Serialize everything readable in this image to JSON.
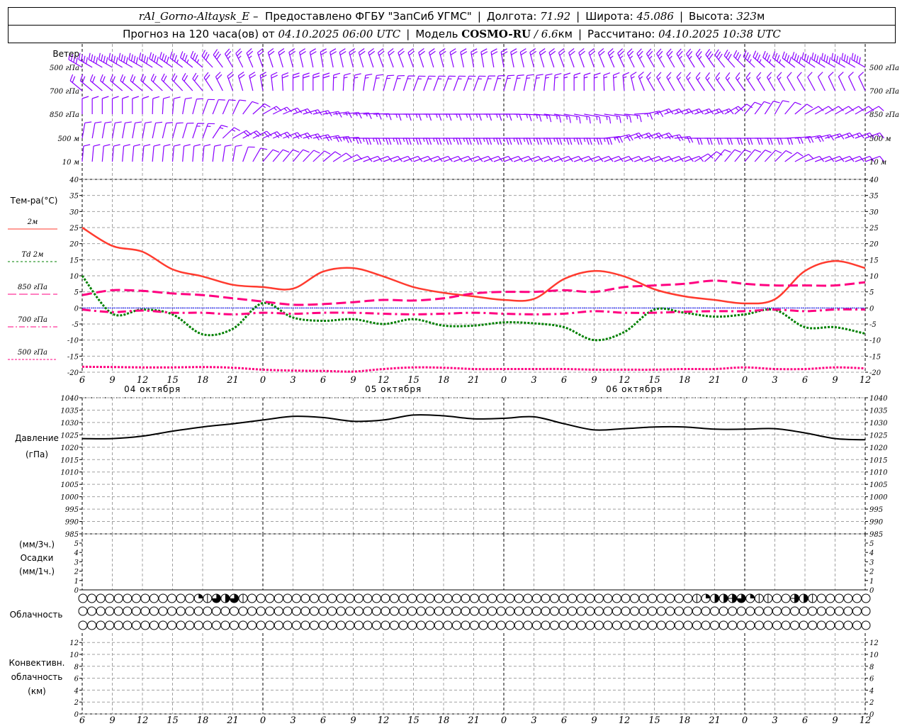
{
  "header": {
    "station": "rAl_Gorno-Altaysk_E",
    "provided_by": " –  Предоставлено ФГБУ \"ЗапСиб УГМС\"",
    "lon_label": "Долгота: ",
    "lon": "71.92",
    "lat_label": "Широта: ",
    "lat": "45.086",
    "alt_label": "Высота: ",
    "alt": "323",
    "alt_unit": "м",
    "forecast_prefix": "Прогноз на 120 часа(ов) от ",
    "forecast_start": "04.10.2025 06:00 UTC",
    "model_label": "Модель ",
    "model": "COSMO-RU",
    "resolution": " / 6.6",
    "resolution_unit": "км",
    "computed_label": "Рассчитано: ",
    "computed": "04.10.2025 10:38 UTC"
  },
  "labels": {
    "wind": "Ветер",
    "wind_levels": [
      "500 гПа",
      "700 гПа",
      "850 гПа",
      "500 м",
      "10 м"
    ],
    "temp_title": "Тем-ра(°C)",
    "legend": [
      "2м",
      "Td  2м",
      "850  гПа",
      "700  гПа",
      "500  гПа"
    ],
    "pressure": "Давление",
    "pressure_unit": "(гПа)",
    "precip_3h": "(мм/3ч.)",
    "precip": "Осадки",
    "precip_1h": "(мм/1ч.)",
    "clouds": "Облачность",
    "conv1": "Конвективн.",
    "conv2": "облачность",
    "conv3": "(км)"
  },
  "x_axis": {
    "ticks": [
      "6",
      "9",
      "12",
      "15",
      "18",
      "21",
      "0",
      "3",
      "6",
      "9",
      "12",
      "15",
      "18",
      "21",
      "0",
      "3",
      "6",
      "9",
      "12",
      "15",
      "18",
      "21",
      "0",
      "3",
      "6",
      "9",
      "12"
    ],
    "dates": [
      "04 октября",
      "05 октября",
      "06 октября"
    ]
  },
  "colors": {
    "wind": "#8a00ff",
    "t2m": "#ff3b2f",
    "td2m": "#008000",
    "levels": "#ff0080",
    "zero_line": "#0000ff",
    "grid": "#a0a0a0"
  },
  "chart_data": [
    {
      "type": "wind-barbs",
      "units": "direction deg / speed m/s, every 3 h",
      "rows": [
        {
          "name": "500 гПа",
          "dir": [
            300,
            300,
            300,
            305,
            310,
            330,
            340,
            345,
            350,
            345,
            340,
            340,
            345,
            350,
            350,
            345,
            340,
            340,
            335,
            330,
            330,
            325,
            315,
            310,
            305,
            300,
            300
          ],
          "speed": [
            22,
            22,
            22,
            20,
            18,
            14,
            12,
            12,
            12,
            12,
            12,
            12,
            12,
            12,
            12,
            12,
            12,
            12,
            13,
            14,
            14,
            15,
            17,
            19,
            21,
            22,
            22
          ]
        },
        {
          "name": "700 гПа",
          "dir": [
            310,
            310,
            310,
            315,
            320,
            340,
            350,
            0,
            0,
            5,
            15,
            20,
            20,
            20,
            15,
            10,
            0,
            0,
            355,
            330,
            330,
            325,
            325,
            330,
            330,
            335,
            335
          ],
          "speed": [
            12,
            12,
            12,
            12,
            12,
            10,
            10,
            10,
            10,
            9,
            8,
            8,
            8,
            8,
            8,
            8,
            8,
            8,
            8,
            8,
            8,
            8,
            8,
            8,
            7,
            7,
            7
          ]
        },
        {
          "name": "850 гПа",
          "dir": [
            0,
            0,
            0,
            5,
            20,
            25,
            60,
            70,
            80,
            85,
            90,
            90,
            90,
            90,
            90,
            95,
            100,
            100,
            95,
            70,
            70,
            70,
            40,
            30,
            60,
            60,
            60
          ],
          "speed": [
            5,
            5,
            5,
            5,
            6,
            7,
            8,
            8,
            8,
            8,
            8,
            8,
            8,
            8,
            8,
            8,
            8,
            8,
            8,
            8,
            8,
            8,
            7,
            6,
            7,
            7,
            7
          ]
        },
        {
          "name": "500 м",
          "dir": [
            10,
            10,
            10,
            15,
            20,
            60,
            65,
            70,
            80,
            90,
            90,
            90,
            90,
            90,
            90,
            90,
            90,
            90,
            70,
            70,
            90,
            90,
            90,
            90,
            80,
            70,
            70
          ],
          "speed": [
            7,
            7,
            7,
            7,
            8,
            10,
            10,
            11,
            12,
            14,
            14,
            14,
            14,
            14,
            14,
            14,
            14,
            14,
            11,
            11,
            12,
            12,
            12,
            12,
            10,
            8,
            8
          ]
        },
        {
          "name": "10 м",
          "dir": [
            5,
            5,
            5,
            5,
            5,
            10,
            40,
            40,
            50,
            70,
            70,
            70,
            70,
            70,
            70,
            70,
            70,
            70,
            70,
            70,
            70,
            40,
            40,
            45,
            70,
            70,
            70
          ],
          "speed": [
            5,
            5,
            5,
            5,
            5,
            5,
            6,
            6,
            6,
            6,
            6,
            6,
            7,
            7,
            7,
            7,
            7,
            7,
            7,
            7,
            7,
            6,
            6,
            6,
            6,
            6,
            6
          ]
        }
      ]
    },
    {
      "type": "line",
      "ylabel": "Тем-ра(°C)",
      "ylim": [
        -20,
        40
      ],
      "yticks": [
        40,
        35,
        30,
        25,
        20,
        15,
        10,
        5,
        0,
        -5,
        -10,
        -15,
        -20
      ],
      "grid": true,
      "series": [
        {
          "name": "2м",
          "style": "solid",
          "values": [
            25,
            19.3,
            17.5,
            12,
            9.8,
            7.2,
            6.5,
            6.0,
            11.3,
            12.4,
            9.8,
            6.5,
            4.7,
            3.6,
            2.5,
            2.8,
            9.0,
            11.5,
            9.8,
            5.8,
            3.6,
            2.5,
            1.4,
            2.7,
            11.5,
            14.6,
            12.4
          ]
        },
        {
          "name": "Td  2м",
          "style": "dotted",
          "values": [
            10,
            -1.8,
            -0.5,
            -2,
            -8.2,
            -6.5,
            1.5,
            -3,
            -4,
            -3.5,
            -5,
            -3.5,
            -5.5,
            -5.5,
            -4.5,
            -4.8,
            -6,
            -10,
            -7.5,
            -0.5,
            -1.5,
            -2.7,
            -2,
            -0.6,
            -6,
            -6,
            -8
          ]
        },
        {
          "name": "850  гПа",
          "style": "dashed",
          "values": [
            4,
            5.5,
            5.3,
            4.5,
            4,
            3,
            2,
            1,
            1.2,
            1.8,
            2.5,
            2.3,
            3,
            4.5,
            5,
            5,
            5.5,
            5,
            6.5,
            7,
            7.5,
            8.5,
            7.5,
            7,
            7,
            7,
            8
          ]
        },
        {
          "name": "700  гПа",
          "style": "dashdot",
          "values": [
            -0.5,
            -1.3,
            -0.8,
            -1.5,
            -1.5,
            -2,
            -1.5,
            -1.8,
            -1.5,
            -1.5,
            -1.8,
            -2,
            -1.8,
            -1.5,
            -1.8,
            -2,
            -1.8,
            -1,
            -1.5,
            -1.5,
            -1.2,
            -1,
            -1,
            -0.5,
            -1,
            -0.5,
            -0.5
          ]
        },
        {
          "name": "500  гПа",
          "style": "fine-dotted",
          "values": [
            -18.3,
            -18.4,
            -18.5,
            -18.5,
            -18.4,
            -18.6,
            -19.2,
            -19.5,
            -19.6,
            -19.8,
            -19,
            -18.5,
            -18.6,
            -19,
            -19,
            -19,
            -19,
            -19.2,
            -19.2,
            -19.2,
            -19,
            -19,
            -18.5,
            -19,
            -19,
            -18.5,
            -18.8
          ]
        }
      ]
    },
    {
      "type": "line",
      "ylabel": "Давление (гПа)",
      "ylim": [
        985,
        1040
      ],
      "yticks": [
        1040,
        1035,
        1030,
        1025,
        1020,
        1015,
        1010,
        1005,
        1000,
        995,
        990,
        985
      ],
      "grid": true,
      "series": [
        {
          "values": [
            1023.5,
            1023.5,
            1024.5,
            1026.5,
            1028.2,
            1029.5,
            1031,
            1032.5,
            1032,
            1030.5,
            1031,
            1033,
            1032.7,
            1031.5,
            1031.7,
            1032.3,
            1029.5,
            1027,
            1027.5,
            1028.2,
            1028.2,
            1027.3,
            1027.3,
            1027.5,
            1025.8,
            1023.5,
            1023
          ]
        }
      ]
    },
    {
      "type": "bar",
      "ylabel": "Осадки",
      "ylim": [
        0,
        5
      ],
      "yticks": [
        5,
        4,
        3,
        2,
        1,
        0
      ],
      "values": []
    },
    {
      "type": "table",
      "ylabel": "Облачность",
      "oktas_rows": [
        "00000000000002164610000000000000000000000000000000000000000000000000012445621100541000000",
        "00000000000000000000000000000000000000000000000000000000000000000000000000000000000000000",
        "00000000000000000000000000000000000000000000000000000000000000000000000000000000000000000"
      ]
    },
    {
      "type": "bar",
      "ylabel": "Конвективн. облачность (км)",
      "ylim": [
        0,
        13
      ],
      "yticks": [
        12,
        10,
        8,
        6,
        4,
        2,
        0
      ],
      "values": []
    }
  ]
}
